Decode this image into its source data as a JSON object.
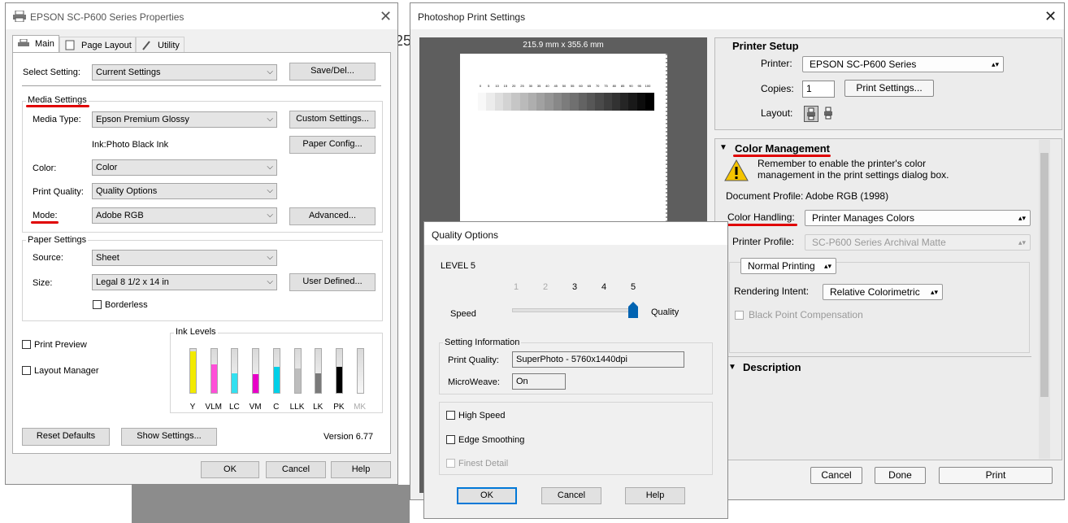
{
  "epson": {
    "title": "EPSON SC-P600 Series Properties",
    "tabs": [
      {
        "label": "Main"
      },
      {
        "label": "Page Layout"
      },
      {
        "label": "Utility"
      }
    ],
    "select_setting_label": "Select Setting:",
    "select_setting_value": "Current Settings",
    "save_del_label": "Save/Del...",
    "media_settings_title": "Media Settings",
    "media_type_label": "Media Type:",
    "media_type_value": "Epson Premium Glossy",
    "custom_settings_label": "Custom Settings...",
    "ink_text": "Ink:Photo Black Ink",
    "paper_config_label": "Paper Config...",
    "color_label": "Color:",
    "color_value": "Color",
    "print_quality_label": "Print Quality:",
    "print_quality_value": "Quality Options",
    "mode_label": "Mode:",
    "mode_value": "Adobe RGB",
    "advanced_label": "Advanced...",
    "paper_settings_title": "Paper Settings",
    "source_label": "Source:",
    "source_value": "Sheet",
    "size_label": "Size:",
    "size_value": "Legal 8 1/2 x 14 in",
    "user_defined_label": "User Defined...",
    "borderless_label": "Borderless",
    "print_preview_label": "Print Preview",
    "layout_manager_label": "Layout Manager",
    "ink_levels_title": "Ink Levels",
    "inks": [
      {
        "label": "Y",
        "color": "#f2ea00",
        "level": 0.95
      },
      {
        "label": "VLM",
        "color": "#ff4fd8",
        "level": 0.65
      },
      {
        "label": "LC",
        "color": "#33e0f0",
        "level": 0.45
      },
      {
        "label": "VM",
        "color": "#e800c8",
        "level": 0.42
      },
      {
        "label": "C",
        "color": "#00d0e8",
        "level": 0.6
      },
      {
        "label": "LLK",
        "color": "#bdbdbd",
        "level": 0.55
      },
      {
        "label": "LK",
        "color": "#7a7a7a",
        "level": 0.45
      },
      {
        "label": "PK",
        "color": "#000000",
        "level": 0.6
      },
      {
        "label": "MK",
        "color": "#d9d9d9",
        "level": 0.0
      }
    ],
    "reset_defaults_label": "Reset Defaults",
    "show_settings_label": "Show Settings...",
    "version": "Version 6.77",
    "ok_label": "OK",
    "cancel_label": "Cancel",
    "help_label": "Help",
    "background_fragment": "25"
  },
  "photoshop": {
    "title": "Photoshop Print Settings",
    "paper_dims": "215.9 mm x 355.6 mm",
    "scale_labels": [
      "0",
      "5",
      "10",
      "15",
      "20",
      "25",
      "30",
      "35",
      "40",
      "45",
      "50",
      "55",
      "60",
      "65",
      "70",
      "75",
      "80",
      "85",
      "90",
      "95",
      "100"
    ],
    "printer_setup_title": "Printer Setup",
    "printer_label": "Printer:",
    "printer_value": "EPSON SC-P600 Series",
    "copies_label": "Copies:",
    "copies_value": "1",
    "print_settings_label": "Print Settings...",
    "layout_label": "Layout:",
    "color_management_title": "Color Management",
    "warning_text_1": "Remember to enable the printer's color",
    "warning_text_2": "management in the print settings dialog box.",
    "document_profile_text": "Document Profile: Adobe RGB (1998)",
    "color_handling_label": "Color Handling:",
    "color_handling_value": "Printer Manages Colors",
    "printer_profile_label": "Printer Profile:",
    "printer_profile_value": "SC-P600 Series Archival Matte",
    "normal_printing_value": "Normal Printing",
    "rendering_intent_label": "Rendering Intent:",
    "rendering_intent_value": "Relative Colorimetric",
    "black_point_label": "Black Point Compensation",
    "description_title": "Description",
    "cancel_label": "Cancel",
    "done_label": "Done",
    "print_label": "Print"
  },
  "quality": {
    "title": "Quality Options",
    "level_text": "LEVEL 5",
    "slider_ticks": [
      "1",
      "2",
      "3",
      "4",
      "5"
    ],
    "slider_level": 5,
    "speed_label": "Speed",
    "quality_label": "Quality",
    "setting_info_title": "Setting Information",
    "print_quality_label": "Print Quality:",
    "print_quality_value": "SuperPhoto - 5760x1440dpi",
    "microweave_label": "MicroWeave:",
    "microweave_value": "On",
    "high_speed_label": "High Speed",
    "edge_smoothing_label": "Edge Smoothing",
    "finest_detail_label": "Finest Detail",
    "ok_label": "OK",
    "cancel_label": "Cancel",
    "help_label": "Help"
  }
}
